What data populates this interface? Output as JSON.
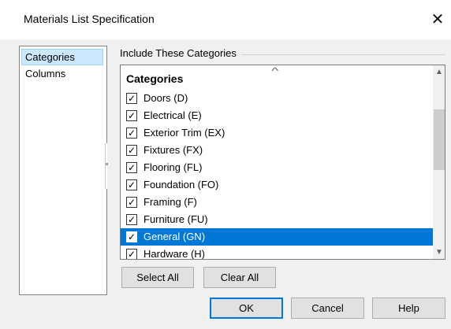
{
  "window": {
    "title": "Materials List Specification",
    "close_glyph": "✕"
  },
  "nav": {
    "items": [
      {
        "label": "Categories",
        "selected": true
      },
      {
        "label": "Columns",
        "selected": false
      }
    ]
  },
  "group": {
    "label": "Include These Categories"
  },
  "list": {
    "header": "Categories",
    "sort_glyph": "^",
    "rows": [
      {
        "label": "Doors (D)",
        "checked": true
      },
      {
        "label": "Electrical (E)",
        "checked": true
      },
      {
        "label": "Exterior Trim (EX)",
        "checked": true
      },
      {
        "label": "Fixtures (FX)",
        "checked": true
      },
      {
        "label": "Flooring (FL)",
        "checked": true
      },
      {
        "label": "Foundation (FO)",
        "checked": true
      },
      {
        "label": "Framing (F)",
        "checked": true
      },
      {
        "label": "Furniture (FU)",
        "checked": true
      },
      {
        "label": "General (GN)",
        "checked": true
      },
      {
        "label": "Hardware (H)",
        "checked": true
      }
    ],
    "selected_index": 8,
    "check_glyph": "✓",
    "scroll_up_glyph": "▲",
    "scroll_down_glyph": "▼"
  },
  "buttons": {
    "select_all": "Select All",
    "clear_all": "Clear All",
    "ok": "OK",
    "cancel": "Cancel",
    "help": "Help"
  },
  "colors": {
    "selection": "#0078d7",
    "nav_selection": "#cce8ff"
  }
}
